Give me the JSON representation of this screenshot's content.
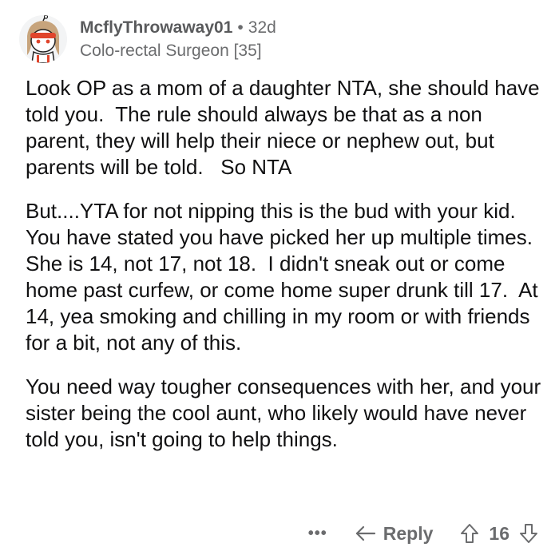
{
  "comment": {
    "author": "McflyThrowaway01",
    "separator": "•",
    "age": "32d",
    "flair": "Colo-rectal Surgeon [35]",
    "paragraphs": [
      "Look OP as a mom of a daughter NTA, she should have told you.  The rule should always be that as a non parent, they will help their niece or nephew out, but parents will be told.   So NTA",
      "But....YTA for not nipping this is the bud with your kid.  You have stated you have picked her up multiple times.  She is 14, not 17, not 18.  I didn't sneak out or come home past curfew, or come home super drunk till 17.  At 14, yea smoking and chilling in my room or with friends for a bit, not any of this.",
      "You need way tougher consequences with her, and your sister being the cool aunt, who likely would have never told you, isn't going to help things."
    ]
  },
  "actions": {
    "more": "•••",
    "reply_label": "Reply",
    "score": "16"
  },
  "icons": {
    "avatar": "snoo-avatar-icon",
    "more": "more-options-icon",
    "reply": "reply-arrow-icon",
    "upvote": "upvote-arrow-icon",
    "downvote": "downvote-arrow-icon"
  },
  "colors": {
    "text": "#111112",
    "meta": "#6b6c6e",
    "background": "#ffffff"
  }
}
